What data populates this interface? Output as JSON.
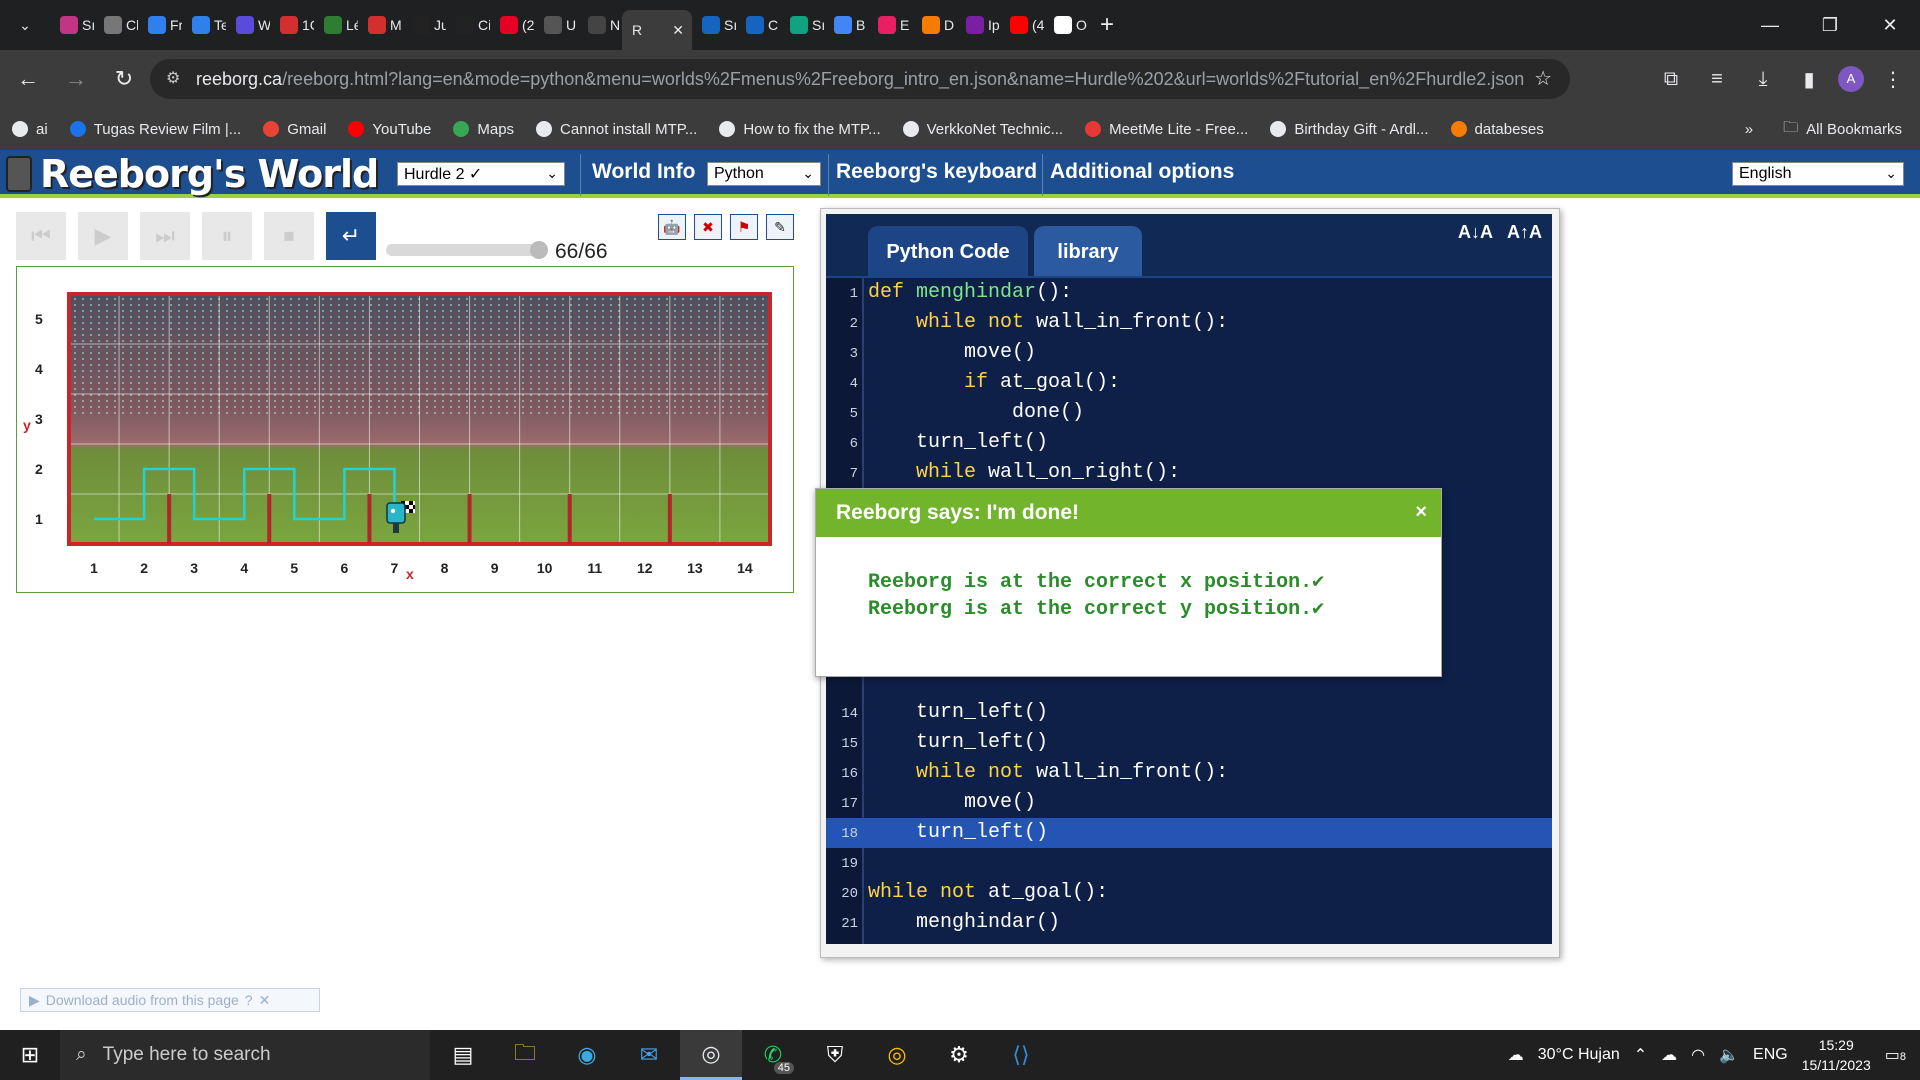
{
  "browser": {
    "tabs": [
      {
        "label": "Sı",
        "color": "#c13584"
      },
      {
        "label": "Cl",
        "color": "#777777"
      },
      {
        "label": "Fr",
        "color": "#2f80ed"
      },
      {
        "label": "Te",
        "color": "#2f80ed"
      },
      {
        "label": "W",
        "color": "#5b4bdb"
      },
      {
        "label": "1C",
        "color": "#d32f2f"
      },
      {
        "label": "Lé",
        "color": "#2e7d32"
      },
      {
        "label": "M",
        "color": "#d32f2f"
      },
      {
        "label": "Ju",
        "color": "#222222"
      },
      {
        "label": "Ci",
        "color": "#222222"
      },
      {
        "label": "(2",
        "color": "#e60023"
      },
      {
        "label": "U",
        "color": "#555555"
      },
      {
        "label": "N",
        "color": "#444444"
      }
    ],
    "active_tab": {
      "label": "R"
    },
    "tabs_after": [
      {
        "label": "Sı",
        "color": "#1565c0"
      },
      {
        "label": "C",
        "color": "#1565c0"
      },
      {
        "label": "Sı",
        "color": "#10a37f"
      },
      {
        "label": "B",
        "color": "#4285f4"
      },
      {
        "label": "E",
        "color": "#e91e63"
      },
      {
        "label": "D",
        "color": "#f57c00"
      },
      {
        "label": "Ip",
        "color": "#7b1fa2"
      },
      {
        "label": "(4",
        "color": "#ff0000"
      },
      {
        "label": "O",
        "color": "#ffffff"
      }
    ],
    "url_host": "reeborg.ca",
    "url_path": "/reeborg.html?lang=en&mode=python&menu=worlds%2Fmenus%2Freeborg_intro_en.json&name=Hurdle%202&url=worlds%2Ftutorial_en%2Fhurdle2.json",
    "avatar_letter": "A",
    "bookmarks": [
      {
        "label": "ai",
        "color": "#e8eaed"
      },
      {
        "label": "Tugas Review Film |...",
        "color": "#1a73e8"
      },
      {
        "label": "Gmail",
        "color": "#ea4335"
      },
      {
        "label": "YouTube",
        "color": "#ff0000"
      },
      {
        "label": "Maps",
        "color": "#34a853"
      },
      {
        "label": "Cannot install MTP...",
        "color": "#e8eaed"
      },
      {
        "label": "How to fix the MTP...",
        "color": "#e8eaed"
      },
      {
        "label": "VerkkoNet Technic...",
        "color": "#e8eaed"
      },
      {
        "label": "MeetMe Lite - Free...",
        "color": "#e53935"
      },
      {
        "label": "Birthday Gift - Ardl...",
        "color": "#e8eaed"
      },
      {
        "label": "databeses",
        "color": "#f57c00"
      }
    ],
    "all_bookmarks": "All Bookmarks"
  },
  "app": {
    "logo": "Reeborg's World",
    "world_select": "Hurdle 2 ✓",
    "world_info": "World Info",
    "language_select": "Python",
    "keyboard": "Reeborg's keyboard",
    "additional_options": "Additional options",
    "ui_language": "English"
  },
  "controls": {
    "step_count": "66/66",
    "progress": 1.0
  },
  "world": {
    "y_labels": [
      "5",
      "4",
      "3",
      "2",
      "1"
    ],
    "x_labels": [
      "1",
      "2",
      "3",
      "4",
      "5",
      "6",
      "7",
      "8",
      "9",
      "10",
      "11",
      "12",
      "13",
      "14"
    ],
    "y_axis": "y",
    "x_axis": "x"
  },
  "editor": {
    "tab_code": "Python Code",
    "tab_library": "library",
    "font_smaller": "A↓A",
    "font_larger": "A↑A"
  },
  "dialog": {
    "title": "Reeborg says: I'm done!",
    "close": "×",
    "line1": "Reeborg is at the correct x position.",
    "line2": "Reeborg is at the correct y position."
  },
  "audio": "Download audio from this page",
  "taskbar": {
    "search": "Type here to search",
    "weather": "30°C  Hujan",
    "lang": "ENG",
    "time": "15:29",
    "date": "15/11/2023",
    "whatsapp_badge": "45",
    "notif_badge": "8"
  }
}
